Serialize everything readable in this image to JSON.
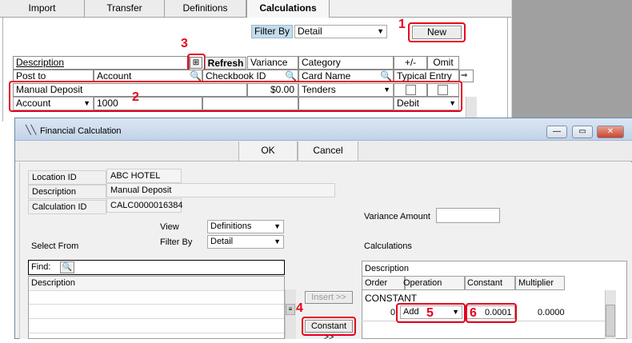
{
  "tabs": [
    {
      "label": "Import",
      "active": false
    },
    {
      "label": "Transfer",
      "active": false
    },
    {
      "label": "Definitions",
      "active": false
    },
    {
      "label": "Calculations",
      "active": true
    }
  ],
  "filter": {
    "label": "Filter By",
    "value": "Detail"
  },
  "new_button": "New",
  "grid": {
    "header_row1": {
      "description": "Description",
      "refresh": "Refresh",
      "variance": "Variance",
      "category": "Category",
      "plus_minus": "+/-",
      "omit": "Omit"
    },
    "header_row2": {
      "post_to": "Post to",
      "account": "Account",
      "checkbook_id": "Checkbook ID",
      "card_name": "Card Name",
      "typical_entry": "Typical Entry"
    },
    "row1": {
      "description": "Manual Deposit",
      "variance": "$0.00",
      "category": "Tenders"
    },
    "row2": {
      "post_to": "Account",
      "account": "1000",
      "typical_entry": "Debit"
    }
  },
  "annotations": {
    "n1": "1",
    "n2": "2",
    "n3": "3",
    "n4": "4",
    "n5": "5",
    "n6": "6"
  },
  "dialog": {
    "title": "Financial Calculation",
    "ok": "OK",
    "cancel": "Cancel",
    "location_id_label": "Location ID",
    "location_id": "ABC HOTEL",
    "description_label": "Description",
    "description": "Manual Deposit",
    "calculation_id_label": "Calculation ID",
    "calculation_id": "CALC0000016384",
    "view_label": "View",
    "view_value": "Definitions",
    "filter_by_label": "Filter By",
    "filter_by_value": "Detail",
    "select_from": "Select From",
    "find_label": "Find:",
    "list_description": "Description",
    "insert_button": "Insert >>",
    "constant_button": "Constant >>",
    "variance_amount_label": "Variance Amount",
    "calculations_label": "Calculations",
    "calc_description_header": "Description",
    "calc_columns": [
      "Order",
      "Operation",
      "Constant",
      "Multiplier"
    ],
    "calc_row_description": "CONSTANT",
    "calc_row": {
      "order": "0",
      "operation": "Add",
      "constant": "0.0001",
      "multiplier": "0.0000"
    }
  },
  "colors": {
    "annotation_red": "#e8001c",
    "filter_label_bg": "#c4dcec",
    "gray_desktop": "#a0a0a0"
  }
}
